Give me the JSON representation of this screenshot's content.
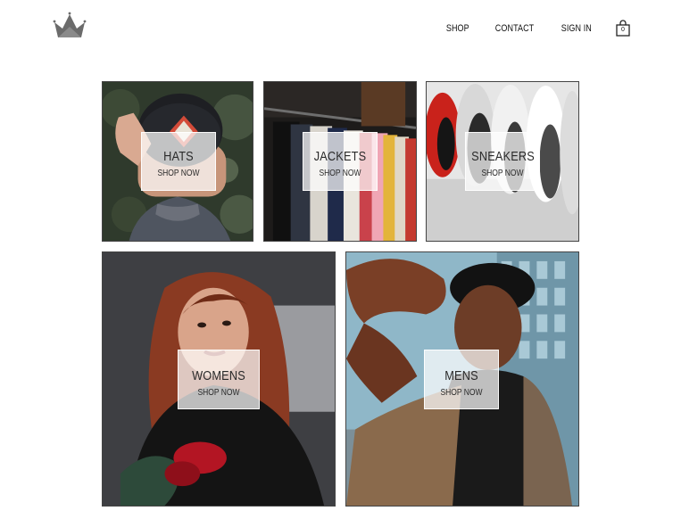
{
  "header": {
    "logo_icon": "crown-icon",
    "nav": {
      "shop": "SHOP",
      "contact": "CONTACT",
      "sign_in": "SIGN IN"
    },
    "cart": {
      "icon": "shopping-bag-icon",
      "count": "0"
    }
  },
  "categories": {
    "hats": {
      "title": "HATS",
      "cta": "SHOP NOW"
    },
    "jackets": {
      "title": "JACKETS",
      "cta": "SHOP NOW"
    },
    "sneakers": {
      "title": "SNEAKERS",
      "cta": "SHOP NOW"
    },
    "womens": {
      "title": "WOMENS",
      "cta": "SHOP NOW"
    },
    "mens": {
      "title": "MENS",
      "cta": "SHOP NOW"
    }
  },
  "colors": {
    "logo": "#6b6b6b",
    "tile_border": "#444444",
    "label_bg": "#ffffffb8"
  }
}
